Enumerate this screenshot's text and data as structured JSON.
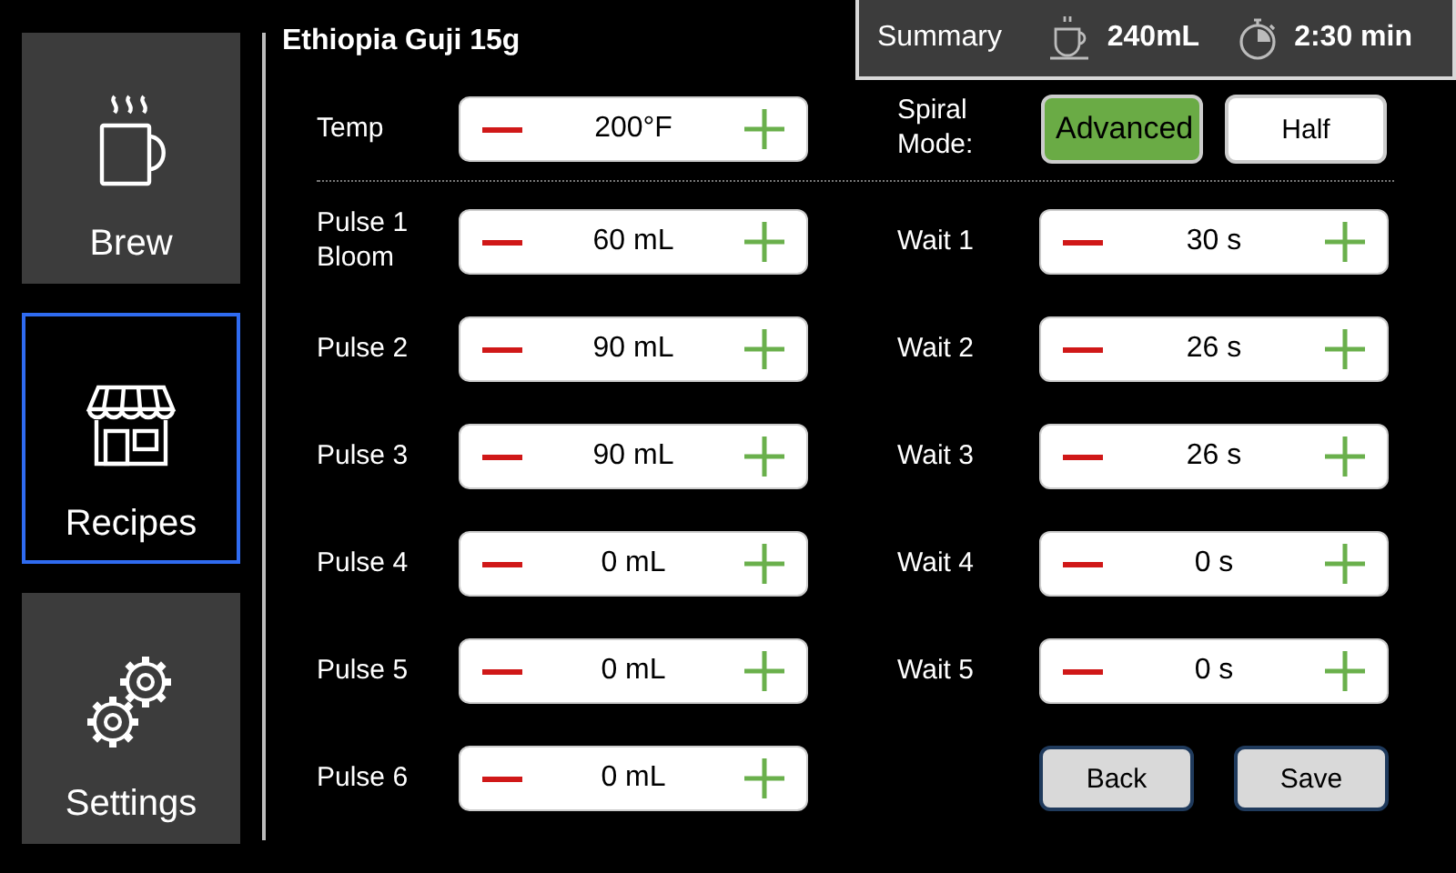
{
  "sidebar": {
    "items": [
      {
        "kind": "brew",
        "label": "Brew",
        "selected": false
      },
      {
        "kind": "recipes",
        "label": "Recipes",
        "selected": true
      },
      {
        "kind": "settings",
        "label": "Settings",
        "selected": false
      }
    ]
  },
  "title": "Ethiopia Guji 15g",
  "summary": {
    "label": "Summary",
    "volume": "240mL",
    "time": "2:30 min"
  },
  "temp": {
    "label": "Temp",
    "value": "200°F"
  },
  "spiral_mode": {
    "label": "Spiral Mode:",
    "options": [
      {
        "label": "Advanced",
        "selected": true
      },
      {
        "label": "Half",
        "selected": false
      }
    ]
  },
  "pulses": [
    {
      "label": "Pulse 1 Bloom",
      "value": "60 mL"
    },
    {
      "label": "Pulse 2",
      "value": "90 mL"
    },
    {
      "label": "Pulse 3",
      "value": "90 mL"
    },
    {
      "label": "Pulse 4",
      "value": "0 mL"
    },
    {
      "label": "Pulse 5",
      "value": "0 mL"
    },
    {
      "label": "Pulse 6",
      "value": "0 mL"
    }
  ],
  "waits": [
    {
      "label": "Wait 1",
      "value": "30 s"
    },
    {
      "label": "Wait 2",
      "value": "26 s"
    },
    {
      "label": "Wait 3",
      "value": "26 s"
    },
    {
      "label": "Wait 4",
      "value": "0 s"
    },
    {
      "label": "Wait 5",
      "value": "0 s"
    }
  ],
  "buttons": [
    "Back",
    "Save"
  ]
}
